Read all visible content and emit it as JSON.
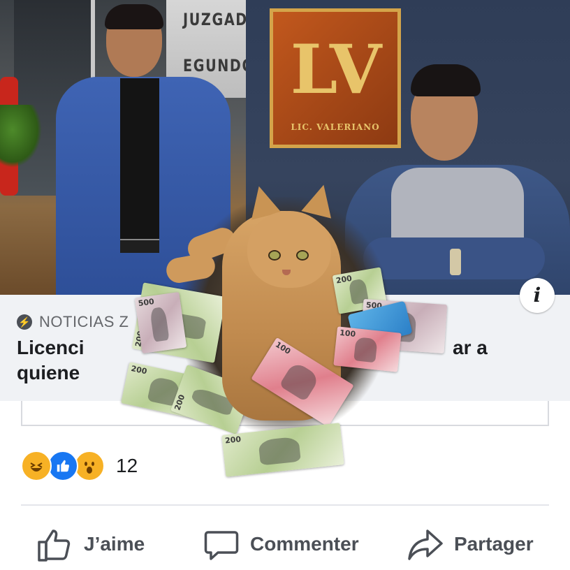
{
  "photo": {
    "sign_line1": "JUZGAD",
    "sign_line2": "EGUNDO C",
    "plaque_logo": "LV",
    "plaque_caption": "LIC. VALERIANO",
    "bills": [
      "200",
      "500",
      "200",
      "200",
      "100",
      "200",
      "500",
      "100",
      "200"
    ],
    "info_badge": "i"
  },
  "preview": {
    "source": "NOTICIAS Z",
    "headline_line1": "Licenci",
    "headline_line1_tail": "ar a",
    "headline_line2": "quiene"
  },
  "reactions": {
    "icons": [
      "haha-reaction-icon",
      "like-reaction-icon",
      "wow-reaction-icon"
    ],
    "count": "12"
  },
  "actions": {
    "like_label": "J’aime",
    "comment_label": "Commenter",
    "share_label": "Partager"
  },
  "colors": {
    "like_blue": "#1877f2",
    "reaction_yellow": "#f7b125",
    "action_gray": "#4b4f56",
    "panel_bg": "#f0f2f5"
  }
}
